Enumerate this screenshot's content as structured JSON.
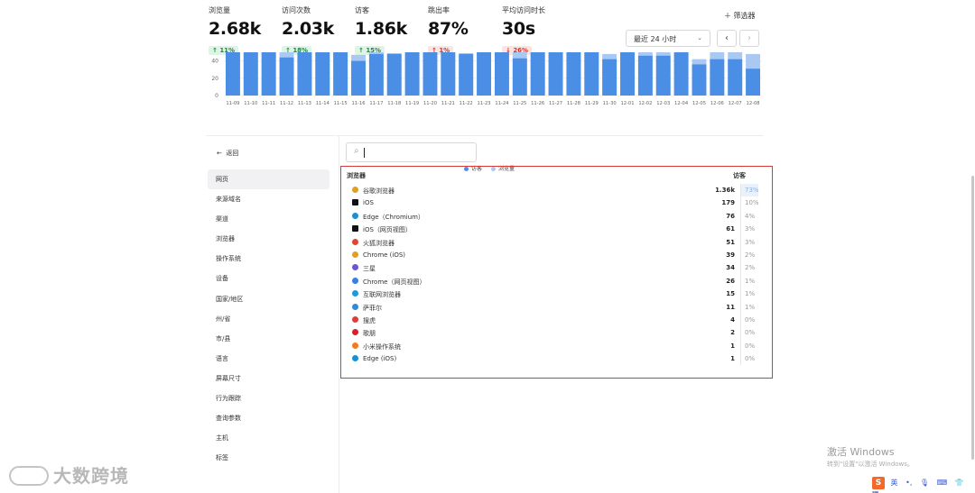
{
  "stats": [
    {
      "label": "浏览量",
      "value": "2.68k",
      "change": "11%",
      "direction": "up"
    },
    {
      "label": "访问次数",
      "value": "2.03k",
      "change": "18%",
      "direction": "up"
    },
    {
      "label": "访客",
      "value": "1.86k",
      "change": "15%",
      "direction": "up"
    },
    {
      "label": "跳出率",
      "value": "87%",
      "change": "1%",
      "direction": "down"
    },
    {
      "label": "平均访问时长",
      "value": "30s",
      "change": "26%",
      "direction": "down"
    }
  ],
  "toolbar": {
    "filter_label": "筛选器",
    "range_label": "最近 24 小时",
    "prev_icon": "‹",
    "next_icon": "›"
  },
  "chart_data": {
    "type": "bar",
    "categories": [
      "11-09",
      "11-10",
      "11-11",
      "11-12",
      "11-13",
      "11-14",
      "11-15",
      "11-16",
      "11-17",
      "11-18",
      "11-19",
      "11-20",
      "11-21",
      "11-22",
      "11-23",
      "11-24",
      "11-25",
      "11-26",
      "11-27",
      "11-28",
      "11-29",
      "11-30",
      "12-01",
      "12-02",
      "12-03",
      "12-04",
      "12-05",
      "12-06",
      "12-07",
      "12-08"
    ],
    "series": [
      {
        "name": "访客",
        "color": "#4a8ee6",
        "values": [
          50,
          50,
          50,
          44,
          50,
          50,
          50,
          40,
          48,
          48,
          50,
          50,
          50,
          48,
          50,
          50,
          43,
          50,
          50,
          50,
          50,
          42,
          50,
          46,
          46,
          50,
          36,
          42,
          42,
          31
        ]
      },
      {
        "name": "浏览量",
        "color": "#a9c8f2",
        "values": [
          50,
          50,
          50,
          50,
          50,
          50,
          50,
          47,
          50,
          49,
          50,
          50,
          50,
          49,
          50,
          50,
          50,
          50,
          50,
          50,
          50,
          48,
          50,
          50,
          50,
          50,
          42,
          50,
          50,
          48
        ]
      }
    ],
    "ylim": [
      0,
      50
    ],
    "yticks": [
      0,
      20,
      40
    ],
    "legend_position": "bottom"
  },
  "legend": {
    "visitors": "访客",
    "pageviews": "浏览量"
  },
  "nav": {
    "back_label": "返回",
    "items": [
      "网页",
      "来源域名",
      "渠道",
      "浏览器",
      "操作系统",
      "设备",
      "国家/地区",
      "州/省",
      "市/县",
      "语言",
      "屏幕尺寸",
      "行为跟踪",
      "查询参数",
      "主机",
      "标签"
    ],
    "active_index": 0
  },
  "table": {
    "header_name": "浏览器",
    "header_value": "访客",
    "rows": [
      {
        "name": "谷歌浏览器",
        "value": "1.36k",
        "pct": "73%",
        "icon": "chrome-icon",
        "color": "#e0a020"
      },
      {
        "name": "iOS",
        "value": "179",
        "pct": "10%",
        "icon": "ios-icon",
        "color": "#111111"
      },
      {
        "name": "Edge（Chromium）",
        "value": "76",
        "pct": "4%",
        "icon": "edge-icon",
        "color": "#1b8fd0"
      },
      {
        "name": "iOS（网页视图）",
        "value": "61",
        "pct": "3%",
        "icon": "ios-webview-icon",
        "color": "#111111"
      },
      {
        "name": "火狐浏览器",
        "value": "51",
        "pct": "3%",
        "icon": "firefox-icon",
        "color": "#e2442d"
      },
      {
        "name": "Chrome (iOS)",
        "value": "39",
        "pct": "2%",
        "icon": "chrome-ios-icon",
        "color": "#e0a020"
      },
      {
        "name": "三星",
        "value": "34",
        "pct": "2%",
        "icon": "samsung-icon",
        "color": "#6b57d6"
      },
      {
        "name": "Chrome（网页视图）",
        "value": "26",
        "pct": "1%",
        "icon": "chrome-webview-icon",
        "color": "#3b7de0"
      },
      {
        "name": "互联网浏览器",
        "value": "15",
        "pct": "1%",
        "icon": "ie-icon",
        "color": "#1d9ad6"
      },
      {
        "name": "萨菲尔",
        "value": "11",
        "pct": "1%",
        "icon": "safari-icon",
        "color": "#2f8ad8"
      },
      {
        "name": "搜虎",
        "value": "4",
        "pct": "0%",
        "icon": "yandex-icon",
        "color": "#e23b3b"
      },
      {
        "name": "歌朋",
        "value": "2",
        "pct": "0%",
        "icon": "opera-icon",
        "color": "#d8202b"
      },
      {
        "name": "小米操作系统",
        "value": "1",
        "pct": "0%",
        "icon": "miui-icon",
        "color": "#f47a20"
      },
      {
        "name": "Edge (iOS)",
        "value": "1",
        "pct": "0%",
        "icon": "edge-ios-icon",
        "color": "#1b8fd0"
      }
    ]
  },
  "watermark": {
    "windows_title": "激活 Windows",
    "windows_sub": "转到\"设置\"以激活 Windows。",
    "brand": "大数跨境"
  },
  "ime": {
    "lang": "英"
  }
}
